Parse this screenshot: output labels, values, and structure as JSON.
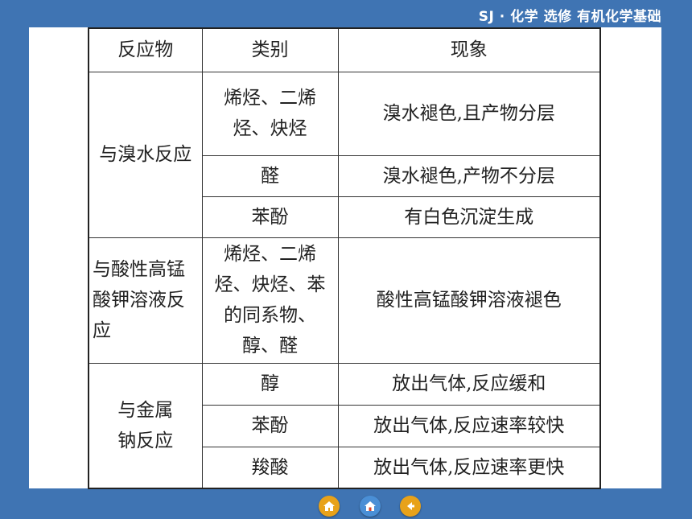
{
  "header": {
    "text": "SJ · 化学  选修  有机化学基础"
  },
  "table": {
    "headers": [
      "反应物",
      "类别",
      "现象"
    ],
    "groups": [
      {
        "reactant": "与溴水反应",
        "rows": [
          {
            "category": "烯烃、二烯烃、炔烃",
            "phenomenon": "溴水褪色,且产物分层"
          },
          {
            "category": "醛",
            "phenomenon": "溴水褪色,产物不分层"
          },
          {
            "category": "苯酚",
            "phenomenon": "有白色沉淀生成"
          }
        ]
      },
      {
        "reactant": "与酸性高锰酸钾溶液反应",
        "rows": [
          {
            "category": "烯烃、二烯烃、炔烃、苯的同系物、醇、醛",
            "phenomenon": "酸性高锰酸钾溶液褪色"
          }
        ]
      },
      {
        "reactant": "与金属钠反应",
        "rows": [
          {
            "category": "醇",
            "phenomenon": "放出气体,反应缓和"
          },
          {
            "category": "苯酚",
            "phenomenon": "放出气体,反应速率较快"
          },
          {
            "category": "羧酸",
            "phenomenon": "放出气体,反应速率更快"
          }
        ]
      }
    ]
  },
  "nav": {
    "buttons": [
      {
        "icon": "home-icon",
        "color": "#e8a21a"
      },
      {
        "icon": "home-main-icon",
        "color": "#4a8fd6"
      },
      {
        "icon": "back-icon",
        "color": "#e8a21a"
      }
    ]
  }
}
